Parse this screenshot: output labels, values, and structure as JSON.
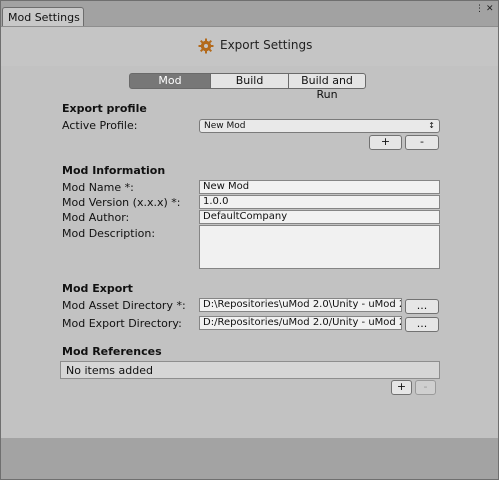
{
  "window": {
    "tab_title": "Mod Settings",
    "ctl_menu": "⋮",
    "ctl_close": "✕"
  },
  "header": {
    "title": "Export Settings",
    "icon": "gear-icon"
  },
  "tabs": [
    {
      "label": "Mod",
      "active": true
    },
    {
      "label": "Build",
      "active": false
    },
    {
      "label": "Build and Run",
      "active": false
    }
  ],
  "export_profile": {
    "heading": "Export profile",
    "active_profile_label": "Active Profile:",
    "active_profile_value": "New Mod",
    "add_label": "+",
    "remove_label": "-"
  },
  "mod_information": {
    "heading": "Mod Information",
    "name_label": "Mod Name *:",
    "name_value": "New Mod",
    "version_label": "Mod Version (x.x.x) *:",
    "version_value": "1.0.0",
    "author_label": "Mod Author:",
    "author_value": "DefaultCompany",
    "description_label": "Mod Description:",
    "description_value": ""
  },
  "mod_export": {
    "heading": "Mod Export",
    "asset_dir_label": "Mod Asset Directory *:",
    "asset_dir_value": "D:\\Repositories\\uMod 2.0\\Unity - uMod 2",
    "export_dir_label": "Mod Export Directory:",
    "export_dir_value": "D:/Repositories/uMod 2.0/Unity - uMod 2",
    "browse_label": "..."
  },
  "mod_references": {
    "heading": "Mod References",
    "empty_text": "No items added",
    "add_label": "+",
    "remove_label": "-"
  }
}
